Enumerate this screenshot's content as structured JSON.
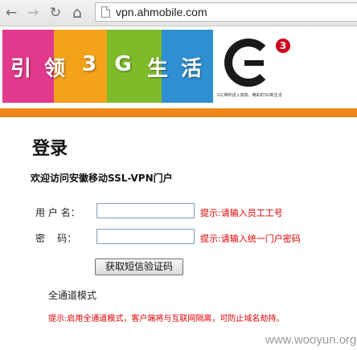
{
  "browser": {
    "url": "vpn.ahmobile.com",
    "back_icon": "←",
    "forward_icon": "→",
    "reload_icon": "↻",
    "home_icon": "⌂"
  },
  "banner": {
    "slogan": [
      "引",
      "领",
      "3",
      "G",
      "生",
      "活"
    ],
    "logo_badge": "3",
    "logo_tagline": "G3,带你进入高效、精彩的3G新生活",
    "accent_color": "#f08519"
  },
  "page": {
    "title": "登录",
    "subtitle": "欢迎访问安徽移动SSL-VPN门户"
  },
  "form": {
    "username_label": "用 户 名：",
    "username_hint": "提示:请输入员工工号",
    "password_label": "密    码：",
    "password_hint": "提示:请输入统一门户密码",
    "sms_button": "获取短信验证码",
    "mode_label": "全通道模式",
    "mode_hint": "提示:启用全通道模式，客户端将与互联网隔离，可防止域名劫持。"
  },
  "watermark": "www.wooyun.org"
}
